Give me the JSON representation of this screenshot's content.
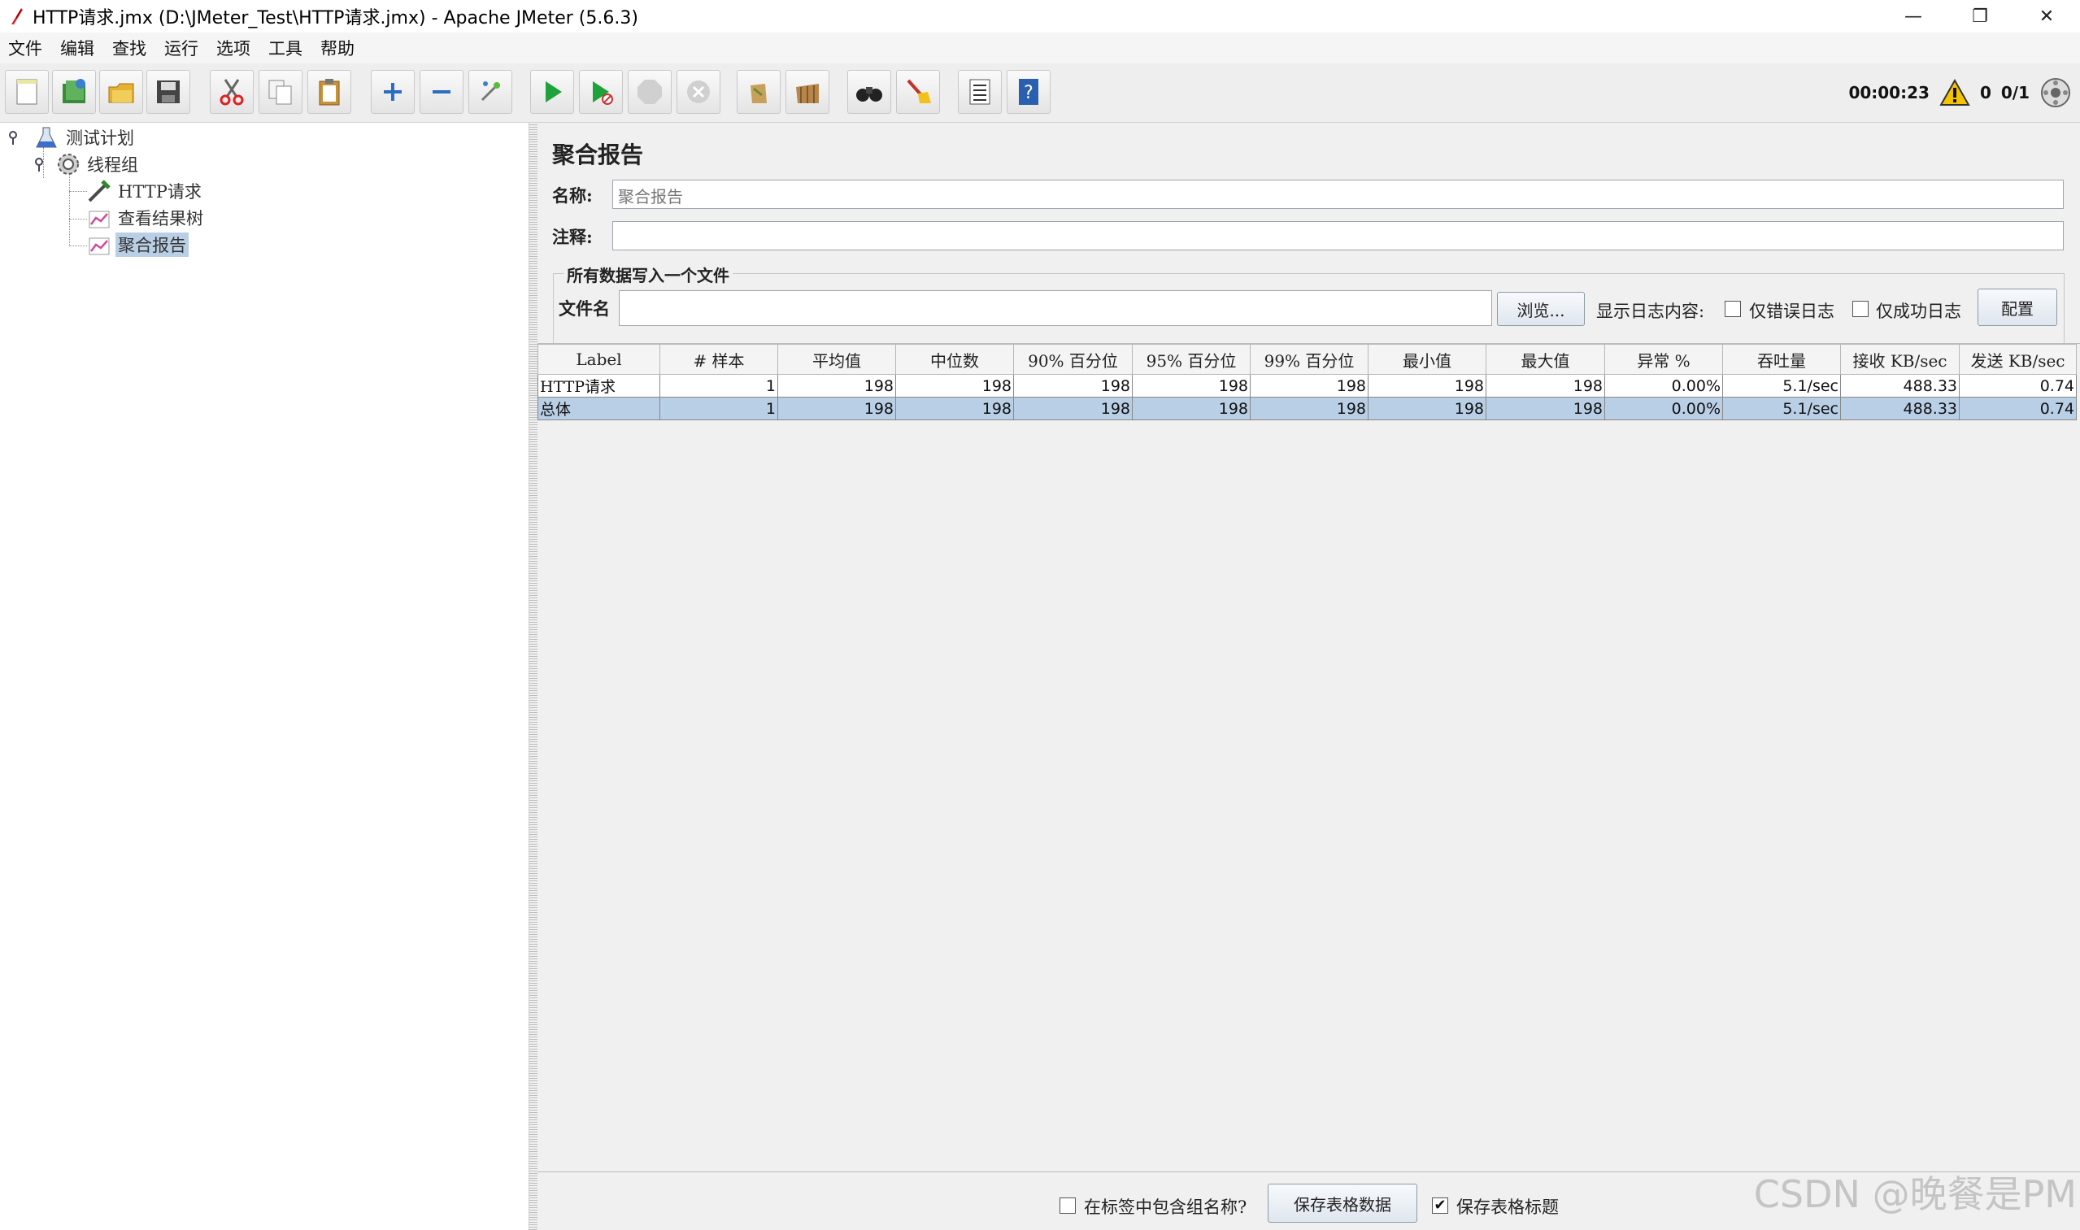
{
  "window": {
    "title": "HTTP请求.jmx (D:\\JMeter_Test\\HTTP请求.jmx) - Apache JMeter (5.6.3)",
    "minimize": "—",
    "restore": "❐",
    "close": "✕"
  },
  "menu": [
    "文件",
    "编辑",
    "查找",
    "运行",
    "选项",
    "工具",
    "帮助"
  ],
  "toolbar": {
    "buttons": [
      "new-icon",
      "templates-icon",
      "open-icon",
      "save-icon",
      "cut-icon",
      "copy-icon",
      "paste-icon",
      "expand-icon",
      "collapse-icon",
      "toggle-icon",
      "start-icon",
      "start-no-pauses-icon",
      "stop-icon",
      "shutdown-icon",
      "clear-icon",
      "clear-all-icon",
      "search-icon",
      "reset-search-icon",
      "function-helper-icon",
      "help-icon"
    ]
  },
  "status": {
    "elapsed": "00:00:23",
    "warnings": "0",
    "threads": "0/1"
  },
  "tree": {
    "items": [
      {
        "label": "测试计划"
      },
      {
        "label": "线程组"
      },
      {
        "label": "HTTP请求"
      },
      {
        "label": "查看结果树"
      },
      {
        "label": "聚合报告"
      }
    ]
  },
  "panel": {
    "title": "聚合报告",
    "name_label": "名称:",
    "name_value": "聚合报告",
    "comment_label": "注释:",
    "comment_value": "",
    "group_title": "所有数据写入一个文件",
    "filename_label": "文件名",
    "filename_value": "",
    "browse_button": "浏览...",
    "log_display_label": "显示日志内容:",
    "errors_only": "仅错误日志",
    "success_only": "仅成功日志",
    "configure_button": "配置"
  },
  "table": {
    "headers": [
      "Label",
      "# 样本",
      "平均值",
      "中位数",
      "90% 百分位",
      "95% 百分位",
      "99% 百分位",
      "最小值",
      "最大值",
      "异常 %",
      "吞吐量",
      "接收 KB/sec",
      "发送 KB/sec"
    ],
    "rows": [
      [
        "HTTP请求",
        "1",
        "198",
        "198",
        "198",
        "198",
        "198",
        "198",
        "198",
        "0.00%",
        "5.1/sec",
        "488.33",
        "0.74"
      ],
      [
        "总体",
        "1",
        "198",
        "198",
        "198",
        "198",
        "198",
        "198",
        "198",
        "0.00%",
        "5.1/sec",
        "488.33",
        "0.74"
      ]
    ]
  },
  "footer": {
    "include_group_label": "在标签中包含组名称?",
    "save_table_button": "保存表格数据",
    "save_header_label": "保存表格标题",
    "save_header_checked": "✔"
  },
  "watermark": "CSDN @晚餐是PM"
}
